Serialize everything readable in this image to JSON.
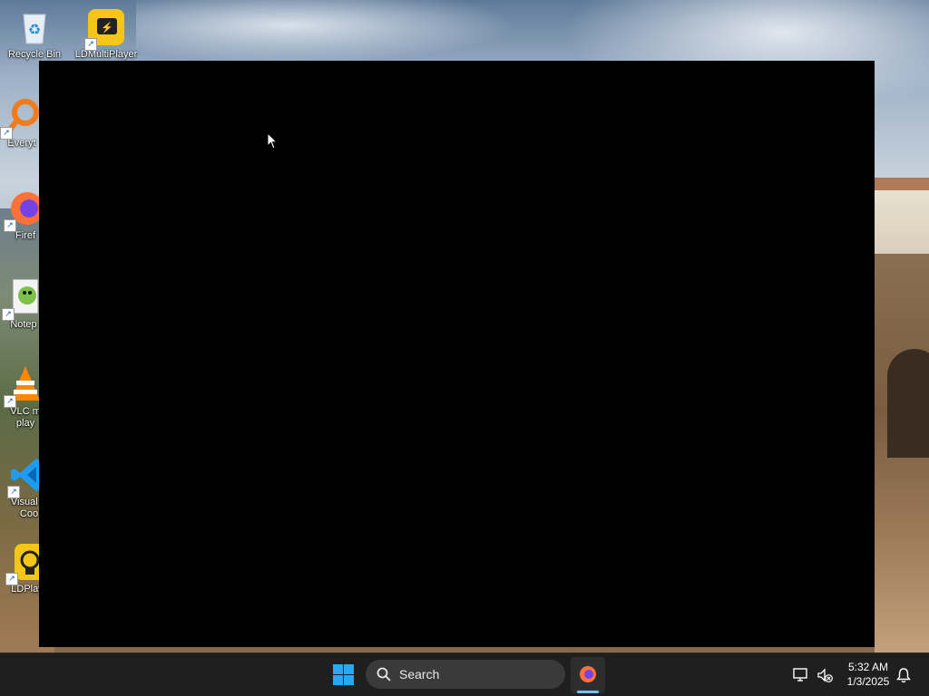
{
  "desktop": {
    "icons": [
      {
        "label": "Recycle Bin",
        "icon": "recycle-bin-icon"
      },
      {
        "label": "LDMultiPlayer",
        "icon": "ldmultiplayer-icon"
      },
      {
        "label": "Everyt",
        "icon": "everything-search-icon"
      },
      {
        "label": "Firef",
        "icon": "firefox-icon"
      },
      {
        "label": "Notep",
        "icon": "notepad-plus-plus-icon"
      },
      {
        "label": "VLC m",
        "label2": "play",
        "icon": "vlc-icon"
      },
      {
        "label": "Visual S",
        "label2": "Coo",
        "icon": "vscode-icon"
      },
      {
        "label": "LDPlay",
        "icon": "ldplayer-icon"
      }
    ]
  },
  "window": {
    "content": "",
    "background": "#000000"
  },
  "taskbar": {
    "search_placeholder": "Search",
    "pinned_apps": [
      {
        "name": "firefox-icon",
        "active": true
      }
    ],
    "tray": {
      "icons": [
        "display-network-icon",
        "sound-muted-icon",
        "notification-bell-icon"
      ]
    },
    "clock": {
      "time": "5:32 AM",
      "date": "1/3/2025"
    }
  },
  "colors": {
    "accent": "#2aa7f3",
    "taskbar": "#1f1f1f"
  }
}
